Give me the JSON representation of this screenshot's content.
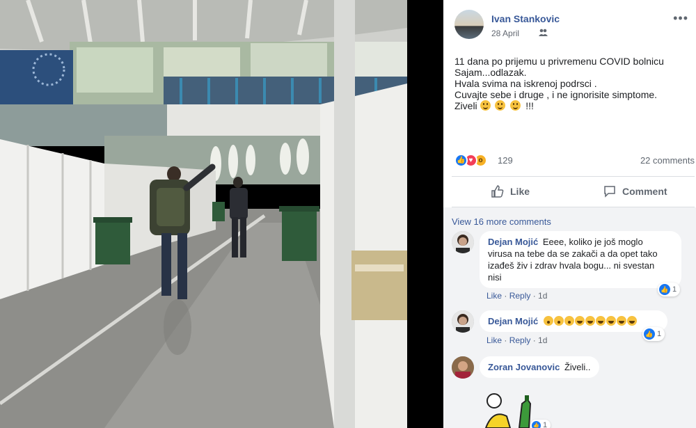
{
  "post": {
    "author": "Ivan Stankovic",
    "date": "28 April",
    "audience_icon": "friends-icon",
    "more_label": "•••",
    "text_lines": [
      "11 dana po prijemu u privremenu COVID bolnicu",
      "Sajam...odlazak.",
      "Hvala svima na iskrenoj podrsci .",
      "Cuvajte sebe i druge , i ne ignorisite simptome."
    ],
    "last_line_prefix": "Ziveli",
    "last_line_suffix": "!!!",
    "reactions_count": "129",
    "comments_count": "22 comments",
    "like_label": "Like",
    "comment_label": "Comment"
  },
  "comments": {
    "view_more": "View 16 more comments",
    "items": [
      {
        "name": "Dejan Mojić",
        "text_lines": [
          "Eeee, koliko je još moglo",
          "virusa na tebe da se zakači a da opet tako",
          "izađeš živ i zdrav hvala bogu... ni svestan",
          "nisi"
        ],
        "like": "Like",
        "reply": "Reply",
        "time": "1d",
        "reactions": "1"
      },
      {
        "name": "Dejan Mojić",
        "text_lines": [
          ""
        ],
        "like": "Like",
        "reply": "Reply",
        "time": "1d",
        "reactions": "1"
      },
      {
        "name": "Zoran Jovanovic",
        "text_lines": [
          "Živeli.."
        ],
        "reactions": "1"
      }
    ]
  },
  "colors": {
    "link_blue": "#385898",
    "like_blue": "#1877f2",
    "love_red": "#f33e58",
    "wow_yellow": "#f7b125"
  }
}
